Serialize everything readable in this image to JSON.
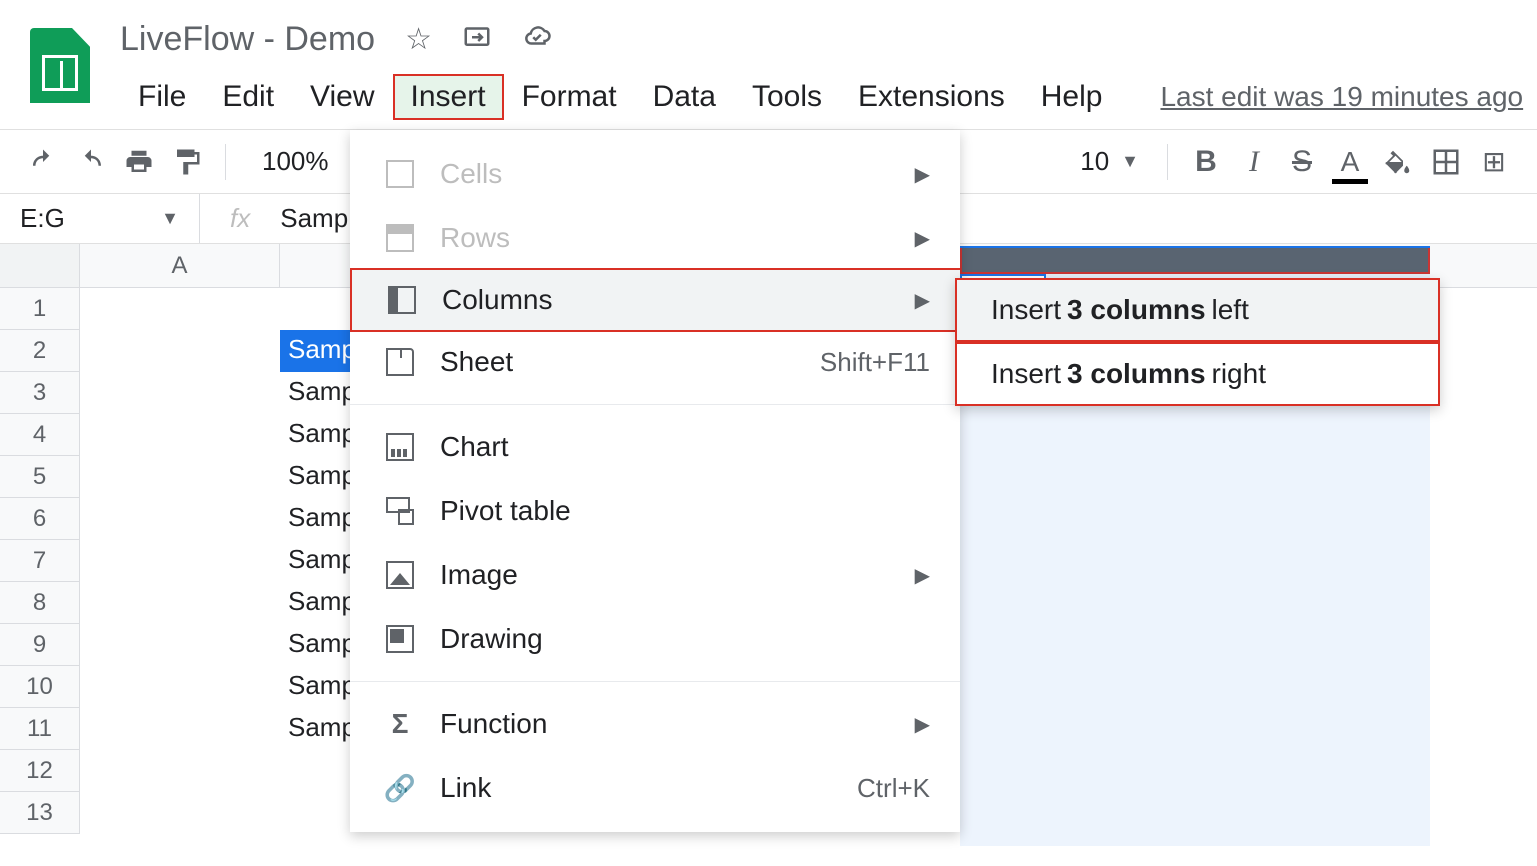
{
  "doc_title": "LiveFlow - Demo",
  "menu": {
    "file": "File",
    "edit": "Edit",
    "view": "View",
    "insert": "Insert",
    "format": "Format",
    "data": "Data",
    "tools": "Tools",
    "extensions": "Extensions",
    "help": "Help"
  },
  "last_edit": "Last edit was 19 minutes ago",
  "toolbar": {
    "zoom": "100%",
    "font_size": "10"
  },
  "name_box": "E:G",
  "formula_preview": "Samp",
  "column_A_header": "A",
  "cells": {
    "b2": "Samp",
    "b3": "Samp",
    "b4": "Samp",
    "b5": "Samp",
    "b6": "Samp",
    "b7": "Samp",
    "b8": "Samp",
    "b9": "Samp",
    "b10": "Samp",
    "b11": "Samp"
  },
  "row_numbers": [
    "1",
    "2",
    "3",
    "4",
    "5",
    "6",
    "7",
    "8",
    "9",
    "10",
    "11",
    "12",
    "13"
  ],
  "insert_menu": {
    "cells": "Cells",
    "rows": "Rows",
    "columns": "Columns",
    "sheet": "Sheet",
    "sheet_shortcut": "Shift+F11",
    "chart": "Chart",
    "pivot": "Pivot table",
    "image": "Image",
    "drawing": "Drawing",
    "function": "Function",
    "link": "Link",
    "link_shortcut": "Ctrl+K"
  },
  "submenu": {
    "left_pre": "Insert ",
    "left_bold": "3 columns",
    "left_post": " left",
    "right_pre": "Insert ",
    "right_bold": "3 columns",
    "right_post": " right"
  }
}
